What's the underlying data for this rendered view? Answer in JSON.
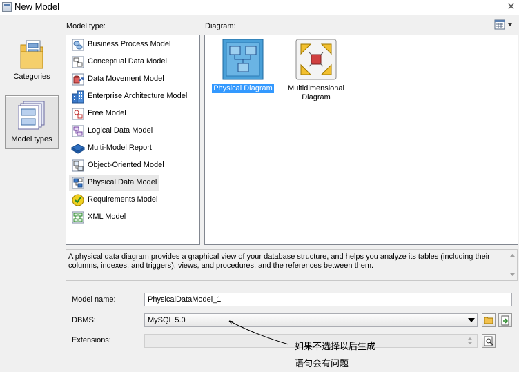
{
  "window": {
    "title": "New Model",
    "close_glyph": "✕"
  },
  "nav": {
    "categories_label": "Categories",
    "model_types_label": "Model types"
  },
  "labels": {
    "model_type": "Model type:",
    "diagram": "Diagram:"
  },
  "model_types": [
    {
      "label": "Business Process Model",
      "icon": "business-process-model-icon"
    },
    {
      "label": "Conceptual Data Model",
      "icon": "conceptual-data-model-icon"
    },
    {
      "label": "Data Movement Model",
      "icon": "data-movement-model-icon"
    },
    {
      "label": "Enterprise Architecture Model",
      "icon": "enterprise-architecture-model-icon"
    },
    {
      "label": "Free Model",
      "icon": "free-model-icon"
    },
    {
      "label": "Logical Data Model",
      "icon": "logical-data-model-icon"
    },
    {
      "label": "Multi-Model Report",
      "icon": "multi-model-report-icon"
    },
    {
      "label": "Object-Oriented Model",
      "icon": "object-oriented-model-icon"
    },
    {
      "label": "Physical Data Model",
      "icon": "physical-data-model-icon"
    },
    {
      "label": "Requirements Model",
      "icon": "requirements-model-icon"
    },
    {
      "label": "XML Model",
      "icon": "xml-model-icon"
    }
  ],
  "selected_model_type": "Physical Data Model",
  "diagrams": [
    {
      "label": "Physical Diagram",
      "icon": "physical-diagram-icon",
      "selected": true
    },
    {
      "label": "Multidimensional Diagram",
      "icon": "multidimensional-diagram-icon",
      "selected": false
    }
  ],
  "description": "A physical data diagram provides a graphical view of your database structure, and helps you analyze its tables (including their columns, indexes, and triggers), views, and procedures, and the references between them.",
  "form": {
    "model_name_label": "Model name:",
    "model_name_value": "PhysicalDataModel_1",
    "dbms_label": "DBMS:",
    "dbms_value": "MySQL 5.0",
    "extensions_label": "Extensions:",
    "extensions_value": ""
  },
  "annotation": {
    "line1": "如果不选择以后生成",
    "line2": "语句会有问题"
  },
  "colors": {
    "selection": "#3399ff",
    "dialog_bg": "#f0f0f0"
  }
}
